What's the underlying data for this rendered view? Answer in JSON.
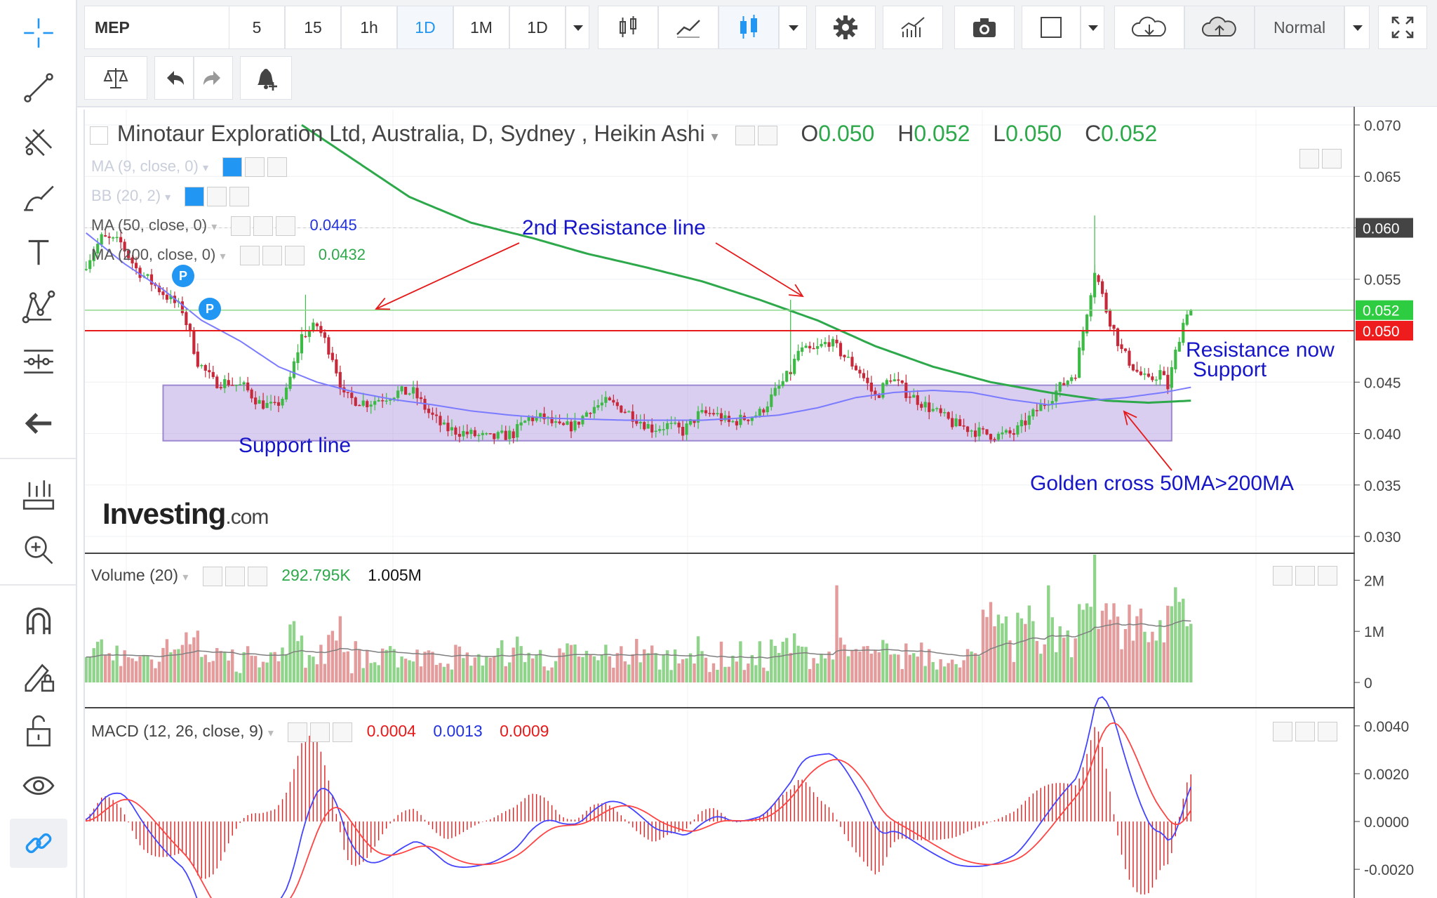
{
  "toolbar": {
    "symbol": "MEP",
    "intervals": [
      "5",
      "15",
      "1h",
      "1D",
      "1M",
      "1D"
    ],
    "active_interval": "1D",
    "price_scale_mode": "Normal"
  },
  "left_tools": [
    "crosshair-icon",
    "trend-line-icon",
    "fib-icon",
    "brush-icon",
    "text-icon",
    "pattern-icon",
    "measure-icon",
    "back-arrow-icon",
    "ruler-icon",
    "zoom-icon",
    "magnet-icon",
    "lock-drawing-icon",
    "unlock-icon",
    "eye-icon",
    "link-icon"
  ],
  "colors": {
    "up": "#3dba45",
    "down": "#c8293a",
    "ma50": "#7b7bff",
    "ma200": "#2da84a",
    "resistance": "#e61a1a",
    "support_zone": "#b9a6e3",
    "annotation": "#1616c8",
    "accent": "#2196f3"
  },
  "main_legend": {
    "title": "Minotaur Exploration Ltd, Australia, D, Sydney , Heikin Ashi",
    "ohlc": [
      {
        "label": "O",
        "value": "0.050"
      },
      {
        "label": "H",
        "value": "0.052"
      },
      {
        "label": "L",
        "value": "0.050"
      },
      {
        "label": "C",
        "value": "0.052"
      }
    ],
    "studies": [
      {
        "name": "MA (9, close, 0)",
        "value": ""
      },
      {
        "name": "BB (20, 2)",
        "value": ""
      },
      {
        "name": "MA (50, close, 0)",
        "value": "0.0445"
      },
      {
        "name": "MA (200, close, 0)",
        "value": "0.0432"
      }
    ]
  },
  "annotations": {
    "second_resistance": "2nd Resistance line",
    "support_line": "Support line",
    "resistance_now_1": "Resistance now",
    "resistance_now_2": "Support",
    "golden_cross": "Golden cross 50MA>200MA"
  },
  "watermark": {
    "brand": "Investing",
    "suffix": ".com"
  },
  "price_axis": {
    "ticks": [
      "0.070",
      "0.065",
      "0.060",
      "0.055",
      "0.045",
      "0.040",
      "0.035",
      "0.030"
    ],
    "labels": [
      {
        "text": "0.060",
        "value": 0.06,
        "style": "dark"
      },
      {
        "text": "0.052",
        "value": 0.052,
        "style": "green"
      },
      {
        "text": "0.050",
        "value": 0.05,
        "style": "red"
      }
    ]
  },
  "volume_pane": {
    "legend": "Volume (20)",
    "values": [
      "292.795K",
      "1.005M"
    ],
    "ticks": [
      "2M",
      "1M",
      "0"
    ]
  },
  "macd_pane": {
    "legend": "MACD (12, 26, close, 9)",
    "values": [
      "0.0004",
      "0.0013",
      "0.0009"
    ],
    "ticks": [
      "0.0040",
      "0.0020",
      "0.0000",
      "-0.0020"
    ]
  },
  "chart_data": {
    "type": "candlestick",
    "title": "Minotaur Exploration Ltd, Australia, D, Sydney , Heikin Ashi",
    "ylim": [
      0.0285,
      0.0715
    ],
    "levels": {
      "resistance": 0.05,
      "last_close": 0.052,
      "support_zone": [
        0.0393,
        0.0447
      ]
    },
    "price_path": [
      [
        0,
        0.056
      ],
      [
        5,
        0.059
      ],
      [
        10,
        0.0585
      ],
      [
        14,
        0.056
      ],
      [
        20,
        0.054
      ],
      [
        26,
        0.052
      ],
      [
        30,
        0.047
      ],
      [
        34,
        0.045
      ],
      [
        38,
        0.045
      ],
      [
        42,
        0.0445
      ],
      [
        46,
        0.043
      ],
      [
        50,
        0.0425
      ],
      [
        53,
        0.044
      ],
      [
        57,
        0.0495
      ],
      [
        61,
        0.0505
      ],
      [
        65,
        0.0475
      ],
      [
        68,
        0.0435
      ],
      [
        74,
        0.043
      ],
      [
        78,
        0.0435
      ],
      [
        82,
        0.044
      ],
      [
        86,
        0.044
      ],
      [
        90,
        0.042
      ],
      [
        94,
        0.0405
      ],
      [
        100,
        0.04
      ],
      [
        106,
        0.0395
      ],
      [
        112,
        0.04
      ],
      [
        116,
        0.0415
      ],
      [
        120,
        0.0415
      ],
      [
        124,
        0.0405
      ],
      [
        128,
        0.0408
      ],
      [
        132,
        0.0425
      ],
      [
        136,
        0.043
      ],
      [
        140,
        0.0425
      ],
      [
        144,
        0.0415
      ],
      [
        148,
        0.0405
      ],
      [
        152,
        0.0408
      ],
      [
        156,
        0.0402
      ],
      [
        160,
        0.0418
      ],
      [
        164,
        0.042
      ],
      [
        168,
        0.041
      ],
      [
        172,
        0.0415
      ],
      [
        176,
        0.042
      ],
      [
        180,
        0.044
      ],
      [
        184,
        0.046
      ],
      [
        186,
        0.048
      ],
      [
        190,
        0.048
      ],
      [
        194,
        0.049
      ],
      [
        198,
        0.0475
      ],
      [
        202,
        0.046
      ],
      [
        206,
        0.0435
      ],
      [
        210,
        0.0455
      ],
      [
        214,
        0.044
      ],
      [
        218,
        0.043
      ],
      [
        222,
        0.042
      ],
      [
        226,
        0.041
      ],
      [
        230,
        0.0405
      ],
      [
        234,
        0.04
      ],
      [
        238,
        0.0398
      ],
      [
        242,
        0.04
      ],
      [
        246,
        0.0415
      ],
      [
        250,
        0.043
      ],
      [
        254,
        0.0445
      ],
      [
        258,
        0.046
      ],
      [
        261,
        0.052
      ],
      [
        263,
        0.056
      ],
      [
        266,
        0.052
      ],
      [
        270,
        0.048
      ],
      [
        274,
        0.046
      ],
      [
        277,
        0.045
      ],
      [
        280,
        0.046
      ],
      [
        282,
        0.0445
      ],
      [
        285,
        0.0495
      ],
      [
        287,
        0.052
      ]
    ],
    "ma50_path": [
      [
        0,
        0.0595
      ],
      [
        10,
        0.0565
      ],
      [
        20,
        0.054
      ],
      [
        30,
        0.051
      ],
      [
        40,
        0.049
      ],
      [
        50,
        0.0465
      ],
      [
        60,
        0.045
      ],
      [
        70,
        0.044
      ],
      [
        80,
        0.0433
      ],
      [
        90,
        0.0428
      ],
      [
        100,
        0.0422
      ],
      [
        110,
        0.0418
      ],
      [
        120,
        0.0415
      ],
      [
        130,
        0.0414
      ],
      [
        140,
        0.0413
      ],
      [
        150,
        0.0413
      ],
      [
        160,
        0.0413
      ],
      [
        170,
        0.0415
      ],
      [
        180,
        0.0418
      ],
      [
        190,
        0.0425
      ],
      [
        200,
        0.0435
      ],
      [
        210,
        0.044
      ],
      [
        220,
        0.0442
      ],
      [
        230,
        0.044
      ],
      [
        240,
        0.0433
      ],
      [
        250,
        0.0428
      ],
      [
        260,
        0.0432
      ],
      [
        270,
        0.0435
      ],
      [
        280,
        0.044
      ],
      [
        287,
        0.0445
      ]
    ],
    "ma200_path": [
      [
        56,
        0.07
      ],
      [
        70,
        0.0665
      ],
      [
        84,
        0.063
      ],
      [
        100,
        0.0605
      ],
      [
        116,
        0.059
      ],
      [
        130,
        0.0575
      ],
      [
        145,
        0.0562
      ],
      [
        160,
        0.0548
      ],
      [
        175,
        0.053
      ],
      [
        190,
        0.051
      ],
      [
        205,
        0.0485
      ],
      [
        220,
        0.0465
      ],
      [
        235,
        0.045
      ],
      [
        250,
        0.044
      ],
      [
        265,
        0.0432
      ],
      [
        276,
        0.043
      ],
      [
        287,
        0.0432
      ]
    ],
    "volume_ylim": [
      0,
      2500000
    ],
    "macd_ylim": [
      -0.0032,
      0.0047
    ]
  }
}
